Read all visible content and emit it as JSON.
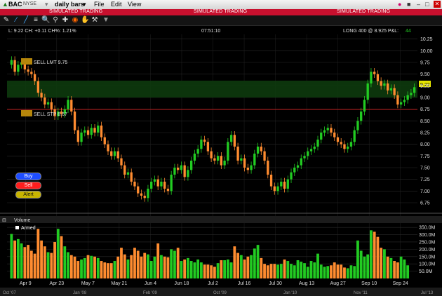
{
  "title_bar": {
    "symbol": "BAC",
    "exchange": "NYSE",
    "bar_type": "daily bars",
    "menus": [
      "File",
      "Edit",
      "View"
    ]
  },
  "banner": {
    "text": "SIMULATED TRADING"
  },
  "header": {
    "last_info": "L: 9.22  CH: +0.11  CH%: 1.21%",
    "time": "07:51:10",
    "position": "LONG 400 @ 8.925 P&L:",
    "pnl": "44"
  },
  "orders": {
    "sell_lmt": "SELL LMT 9.75",
    "sell_stp": "SELL STP 8.67",
    "last_price_tag": "9.22"
  },
  "side_buttons": {
    "buy": "Buy",
    "sell": "Sell",
    "alert": "Alert",
    "armed": "Armed"
  },
  "volume_label": "Volume",
  "colors": {
    "up": "#22cc22",
    "down": "#ff8c30",
    "buy": "#1e4dff",
    "sell": "#ff1e1e",
    "alert": "#c8b400"
  },
  "chart_data": {
    "type": "candlestick",
    "y_ticks": [
      "10.25",
      "10.00",
      "9.75",
      "9.50",
      "9.25",
      "9.00",
      "8.75",
      "8.50",
      "8.25",
      "8.00",
      "7.75",
      "7.50",
      "7.25",
      "7.00",
      "6.75"
    ],
    "ylim": [
      6.6,
      10.35
    ],
    "volume_ticks": [
      "350.0M",
      "300.0M",
      "250.0M",
      "200.0M",
      "150.0M",
      "100.0M",
      "50.0M"
    ],
    "x_labels": [
      "Apr 9",
      "Apr 23",
      "May 7",
      "May 21",
      "Jun 4",
      "Jun 18",
      "Jul 2",
      "Jul 16",
      "Jul 30",
      "Aug 13",
      "Aug 27",
      "Sep 10",
      "Sep 24"
    ],
    "bottom_labels": [
      "Oct '07",
      "Jan '08",
      "Feb '09",
      "Oct '09",
      "Jan '10",
      "Nov '11",
      "Jul '13"
    ],
    "close": [
      9.8,
      9.55,
      9.7,
      9.75,
      9.6,
      9.55,
      9.5,
      9.35,
      9.1,
      9.0,
      8.85,
      8.9,
      8.75,
      8.6,
      8.7,
      8.65,
      8.75,
      8.95,
      8.7,
      8.3,
      8.05,
      8.25,
      8.3,
      8.2,
      8.35,
      8.25,
      8.4,
      8.15,
      8.0,
      7.85,
      7.75,
      7.85,
      7.7,
      7.55,
      7.35,
      7.4,
      7.2,
      7.1,
      6.95,
      6.9,
      6.85,
      7.05,
      7.2,
      7.25,
      7.1,
      7.2,
      7.05,
      7.0,
      7.35,
      7.5,
      7.45,
      7.55,
      7.3,
      7.45,
      7.65,
      7.8,
      7.9,
      8.1,
      8.05,
      7.85,
      7.7,
      7.65,
      7.75,
      7.55,
      7.65,
      8.05,
      8.2,
      7.95,
      7.65,
      7.7,
      7.5,
      7.45,
      7.55,
      7.8,
      7.95,
      7.85,
      7.65,
      7.35,
      7.1,
      7.0,
      7.1,
      7.2,
      7.05,
      7.25,
      7.4,
      7.5,
      7.55,
      7.7,
      7.75,
      7.85,
      7.9,
      7.95,
      8.1,
      8.25,
      8.3,
      8.35,
      8.25,
      8.15,
      8.05,
      8.0,
      7.9,
      7.95,
      8.05,
      8.3,
      8.5,
      8.7,
      8.95,
      9.3,
      9.55,
      9.5,
      9.35,
      9.25,
      9.3,
      9.15,
      9.2,
      9.05,
      8.85,
      8.9,
      8.95,
      9.05,
      9.1,
      9.22
    ],
    "volume": [
      305,
      260,
      270,
      240,
      215,
      230,
      190,
      170,
      340,
      260,
      220,
      180,
      175,
      250,
      340,
      290,
      220,
      180,
      160,
      150,
      120,
      130,
      140,
      160,
      155,
      150,
      140,
      120,
      110,
      105,
      105,
      120,
      150,
      210,
      165,
      130,
      160,
      210,
      190,
      150,
      175,
      165,
      120,
      150,
      240,
      160,
      150,
      145,
      200,
      190,
      210,
      120,
      130,
      140,
      120,
      110,
      130,
      110,
      95,
      95,
      90,
      80,
      105,
      125,
      125,
      130,
      110,
      220,
      175,
      160,
      130,
      150,
      160,
      205,
      230,
      140,
      100,
      90,
      100,
      100,
      95,
      100,
      130,
      120,
      100,
      90,
      125,
      115,
      105,
      80,
      120,
      110,
      170,
      95,
      80,
      85,
      90,
      110,
      95,
      95,
      75,
      70,
      90,
      85,
      260,
      190,
      150,
      165,
      330,
      320,
      285,
      210,
      200,
      150,
      140,
      120,
      110,
      150,
      130,
      90
    ]
  }
}
